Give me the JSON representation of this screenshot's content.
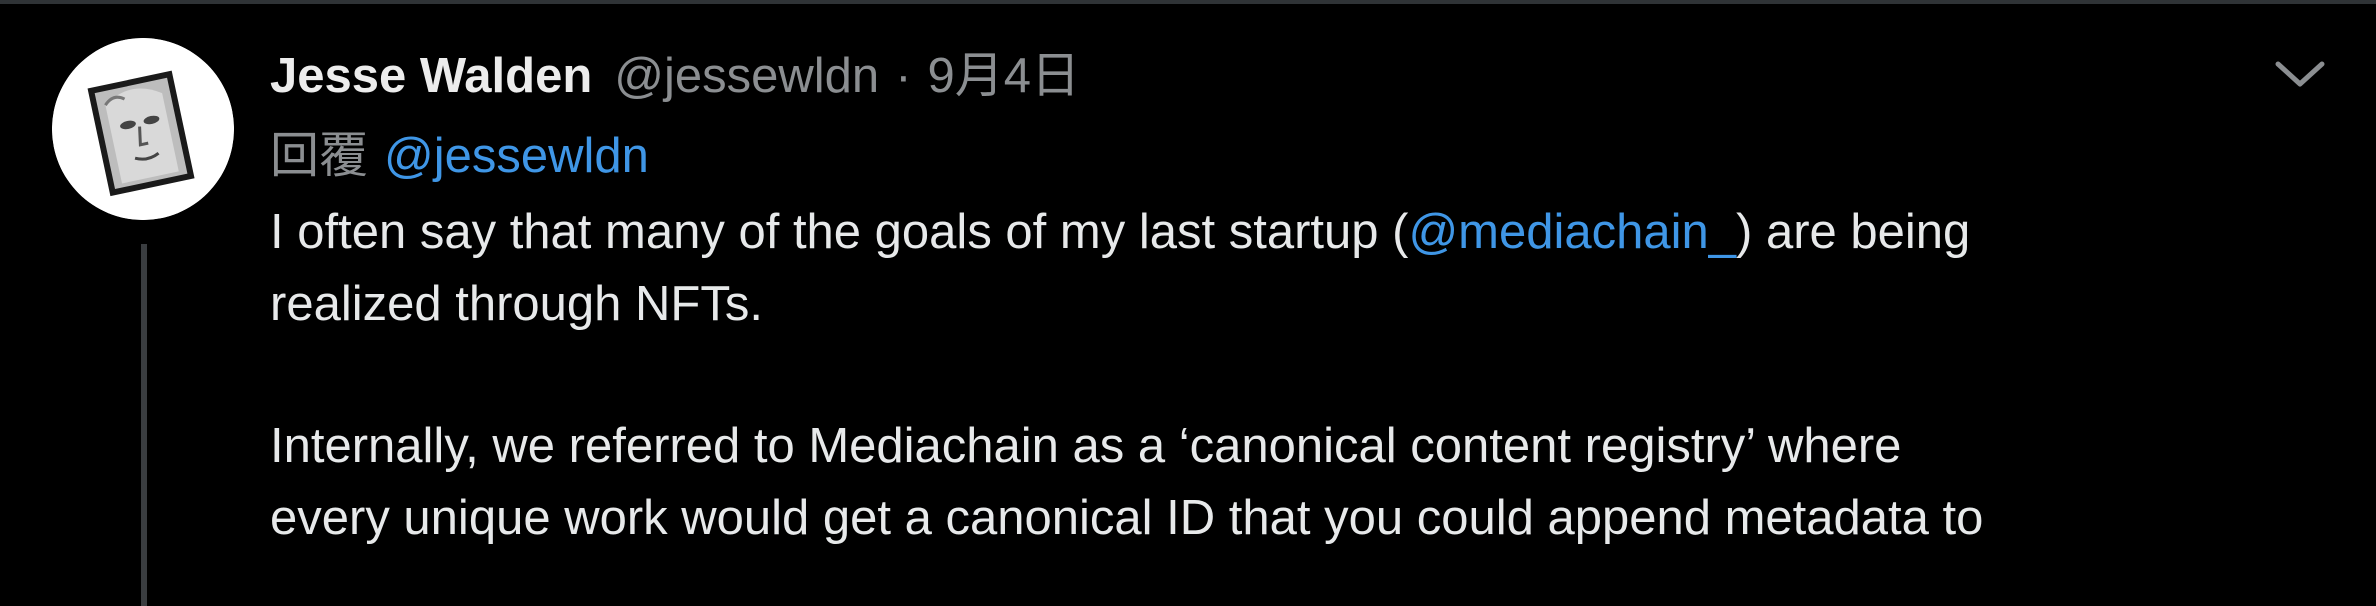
{
  "tweet": {
    "author_name": "Jesse Walden",
    "author_handle": "@jessewldn",
    "separator": "·",
    "date": "9月4日",
    "reply_prefix": "回覆",
    "reply_to_handle": "@jessewldn",
    "paragraph1": {
      "part1": "I often say that many of the goals of my last startup (",
      "mention": "@mediachain_",
      "part2": ") are being",
      "line2": "realized through NFTs."
    },
    "paragraph2": {
      "line1": "Internally, we referred to Mediachain as a ‘canonical content registry’ where",
      "line2": "every unique work would get a canonical ID that you could append metadata to"
    }
  },
  "icons": {
    "avatar": "user-avatar",
    "more": "chevron-down-icon"
  },
  "colors": {
    "background": "#000000",
    "text": "#e7e9ea",
    "secondary_text": "#8b8e91",
    "link": "#3f96e6",
    "thread_line": "#3a3d40"
  }
}
